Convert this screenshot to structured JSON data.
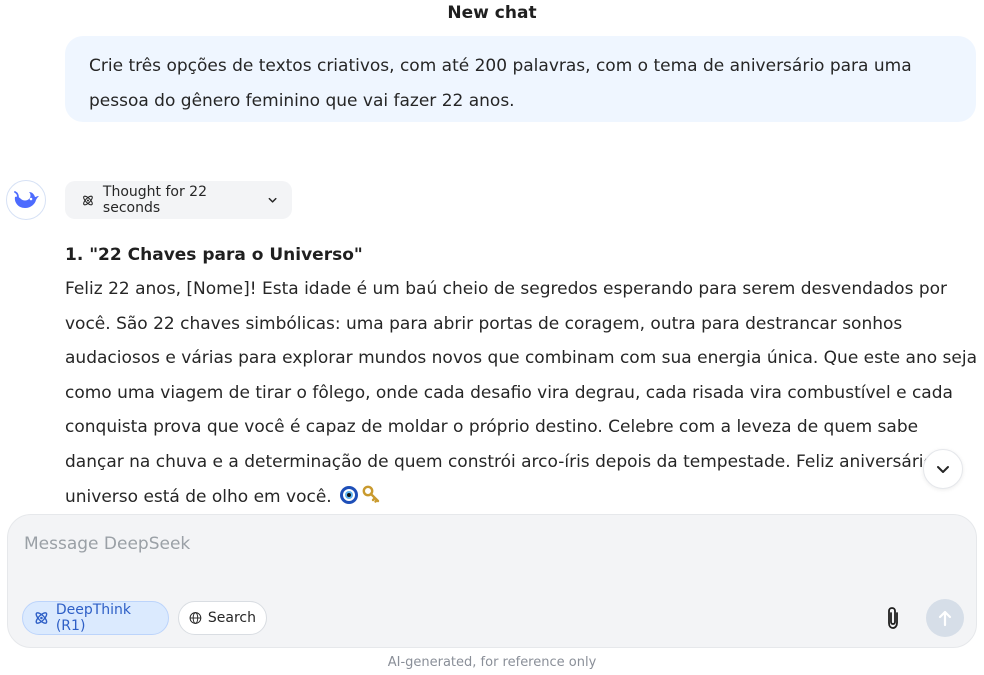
{
  "header": {
    "title": "New chat"
  },
  "user_message": {
    "lines": [
      "Crie três opções de textos criativos, com até 200 palavras, com o tema de aniversário para uma",
      "pessoa do gênero feminino que vai fazer 22 anos."
    ]
  },
  "assistant": {
    "avatar_icon": "whale-logo-icon",
    "thought_chip": {
      "label": "Thought for 22 seconds",
      "icon": "atom-icon"
    },
    "answer": {
      "heading": "1. \"22 Chaves para o Universo\"",
      "lines": [
        "Feliz 22 anos, [Nome]! Esta idade é um baú cheio de segredos esperando para serem desvendados por",
        "você. São 22 chaves simbólicas: uma para abrir portas de coragem, outra para destrancar sonhos",
        "audaciosos e várias para explorar mundos novos que combinam com sua energia única. Que este ano seja",
        "como uma viagem de tirar o fôlego, onde cada desafio vira degrau, cada risada vira combustível e cada",
        "conquista prova que você é capaz de moldar o próprio destino. Celebre com a leveza de quem sabe",
        "dançar na chuva e a determinação de quem constrói arco-íris depois da tempestade. Feliz aniversário",
        "universo está de olho em você."
      ],
      "emojis": [
        "nazar-amulet-emoji",
        "old-key-emoji"
      ]
    }
  },
  "composer": {
    "placeholder": "Message DeepSeek",
    "deepthink_label": "DeepThink (R1)",
    "search_label": "Search",
    "attach_icon": "paperclip-icon",
    "send_icon": "arrow-up-icon"
  },
  "footer": {
    "disclaimer": "AI-generated, for reference only"
  },
  "colors": {
    "user_bubble": "#eff6ff",
    "accent": "#4d6bfe",
    "deepthink_bg": "#dbeafe",
    "composer_bg": "#f3f4f6"
  }
}
